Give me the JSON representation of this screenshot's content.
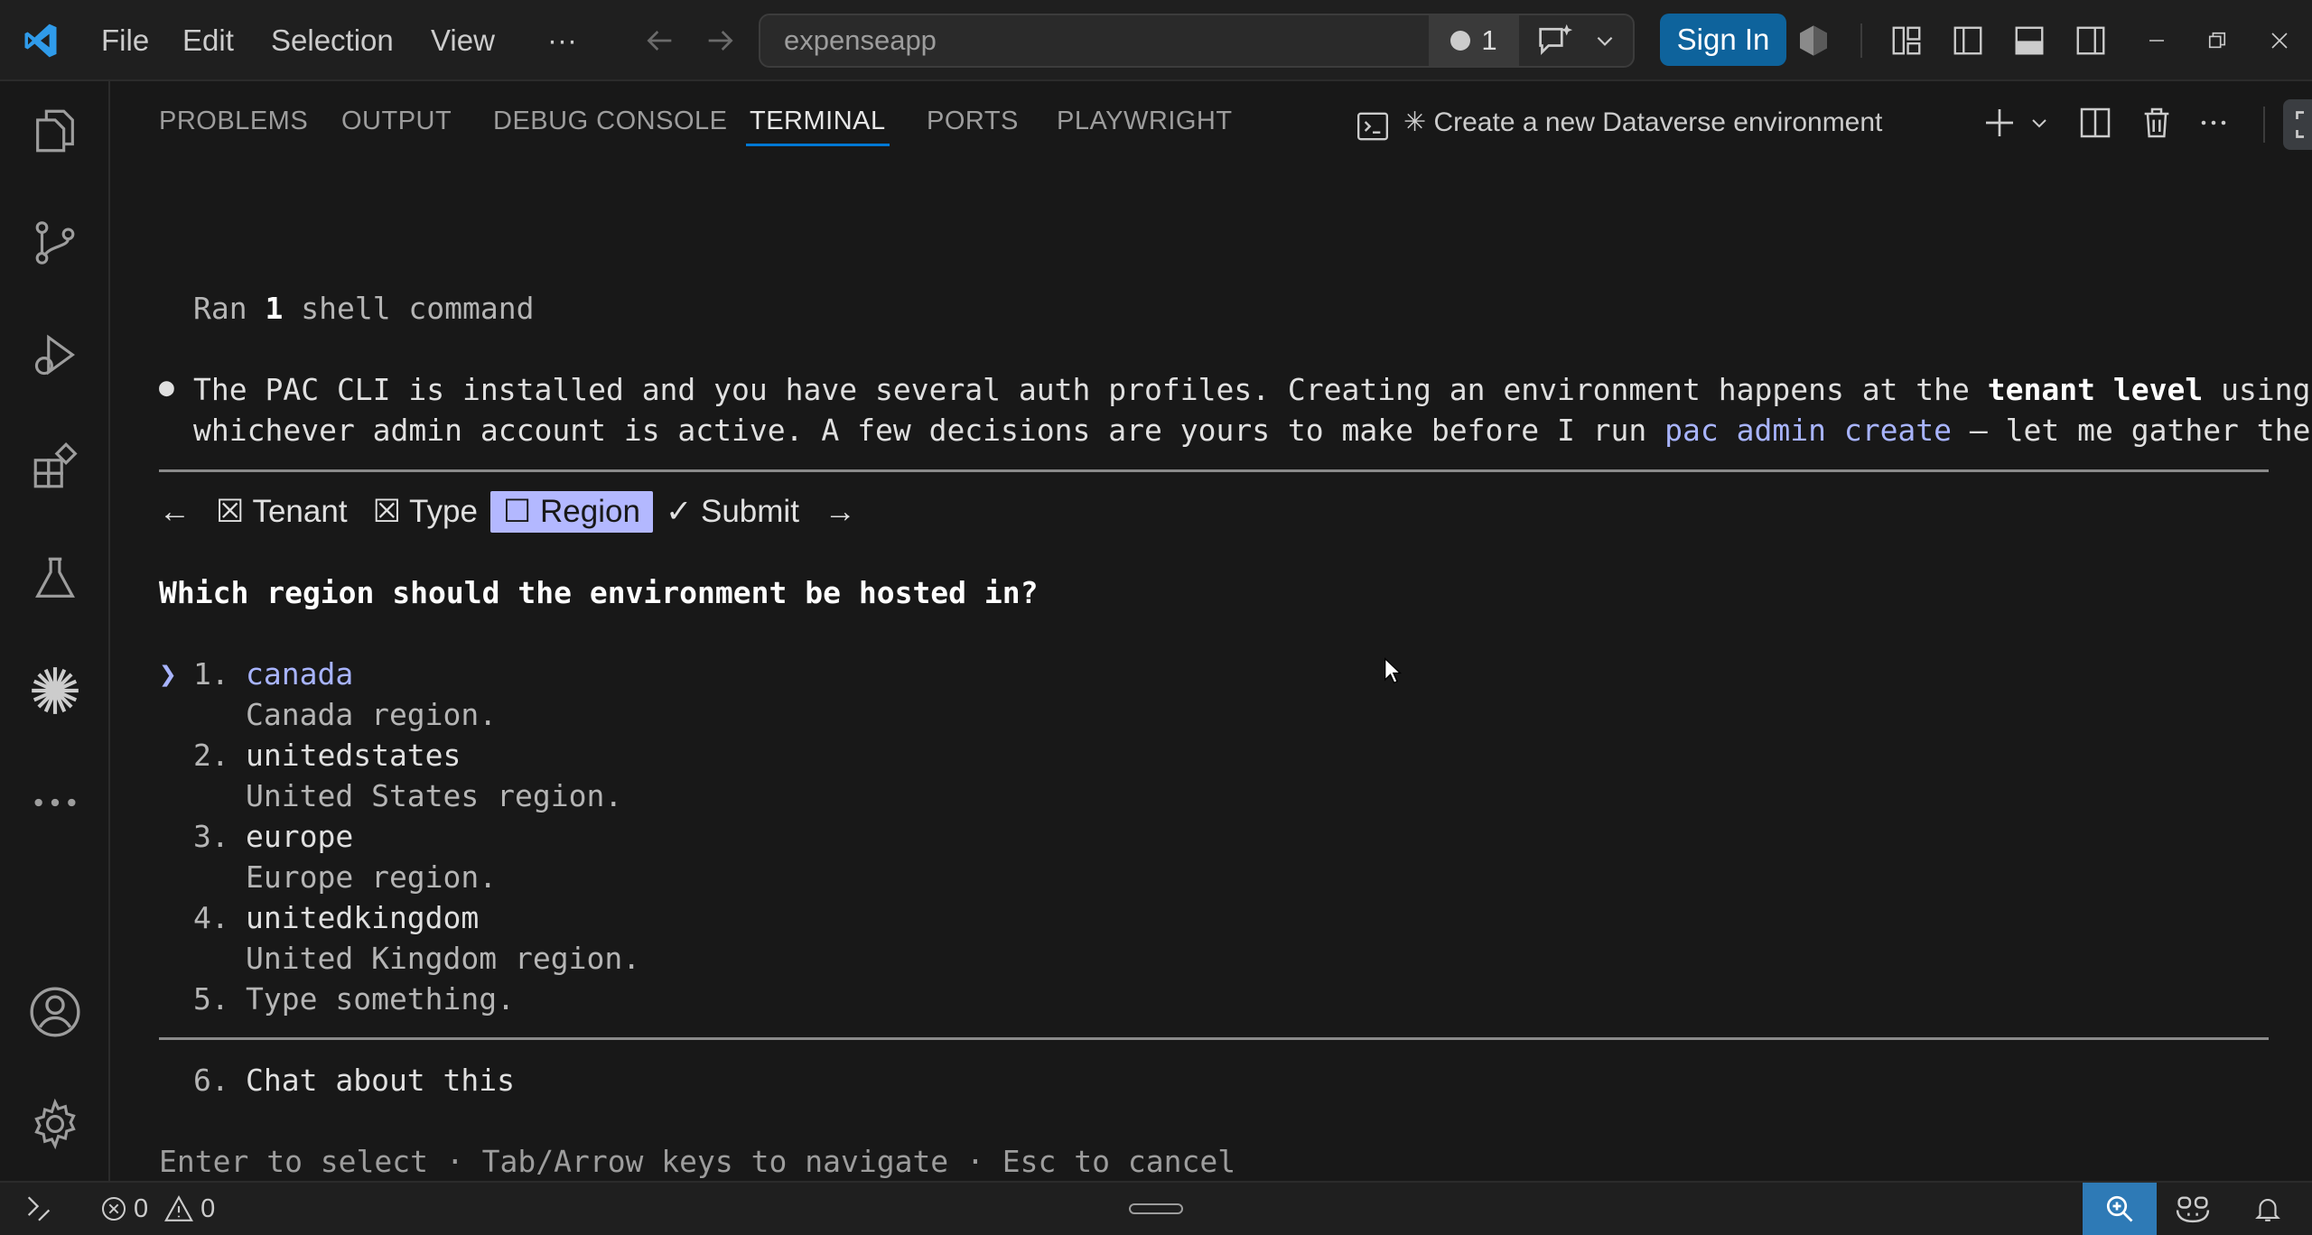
{
  "menu": {
    "file": "File",
    "edit": "Edit",
    "selection": "Selection",
    "view": "View",
    "more": "···"
  },
  "command_center": {
    "text": "expenseapp",
    "badge_count": "1"
  },
  "account": {
    "sign_in": "Sign In"
  },
  "panel": {
    "tabs": [
      "PROBLEMS",
      "OUTPUT",
      "DEBUG CONSOLE",
      "TERMINAL",
      "PORTS",
      "PLAYWRIGHT"
    ],
    "active_tab": "TERMINAL",
    "terminal_title": "✳ Create a new Dataverse environment"
  },
  "terminal": {
    "ran_prefix": "Ran ",
    "ran_count": "1",
    "ran_suffix": " shell command",
    "bullet": "●",
    "msg1_a": "The PAC CLI is installed and you have several auth profiles. Creating an environment happens at the ",
    "msg1_bold": "tenant level",
    "msg1_b": " using",
    "msg2_a": "whichever admin account is active. A few decisions are yours to make before I run ",
    "msg2_link": "pac admin create",
    "msg2_b": " — let me gather them.",
    "steps": {
      "back": "←",
      "tenant": "☒ Tenant",
      "type": "☒ Type",
      "region": "☐ Region",
      "submit": "✓ Submit",
      "forward": "→"
    },
    "question": "Which region should the environment be hosted in?",
    "cursor": "❯",
    "options": [
      {
        "num": "1.",
        "label": "canada",
        "desc": "Canada region."
      },
      {
        "num": "2.",
        "label": "unitedstates",
        "desc": "United States region."
      },
      {
        "num": "3.",
        "label": "europe",
        "desc": "Europe region."
      },
      {
        "num": "4.",
        "label": "unitedkingdom",
        "desc": "United Kingdom region."
      },
      {
        "num": "5.",
        "label": "Type something."
      }
    ],
    "chat_option": {
      "num": "6.",
      "label": "Chat about this"
    },
    "hint": "Enter to select · Tab/Arrow keys to navigate · Esc to cancel"
  },
  "status": {
    "errors": "0",
    "warnings": "0"
  },
  "colors": {
    "accent": "#0078d4",
    "selected_step_bg": "#b3b8ff",
    "link": "#a8b4ff",
    "sign_in_bg": "#0e639c",
    "status_zoom_bg": "#2e7ab6"
  }
}
